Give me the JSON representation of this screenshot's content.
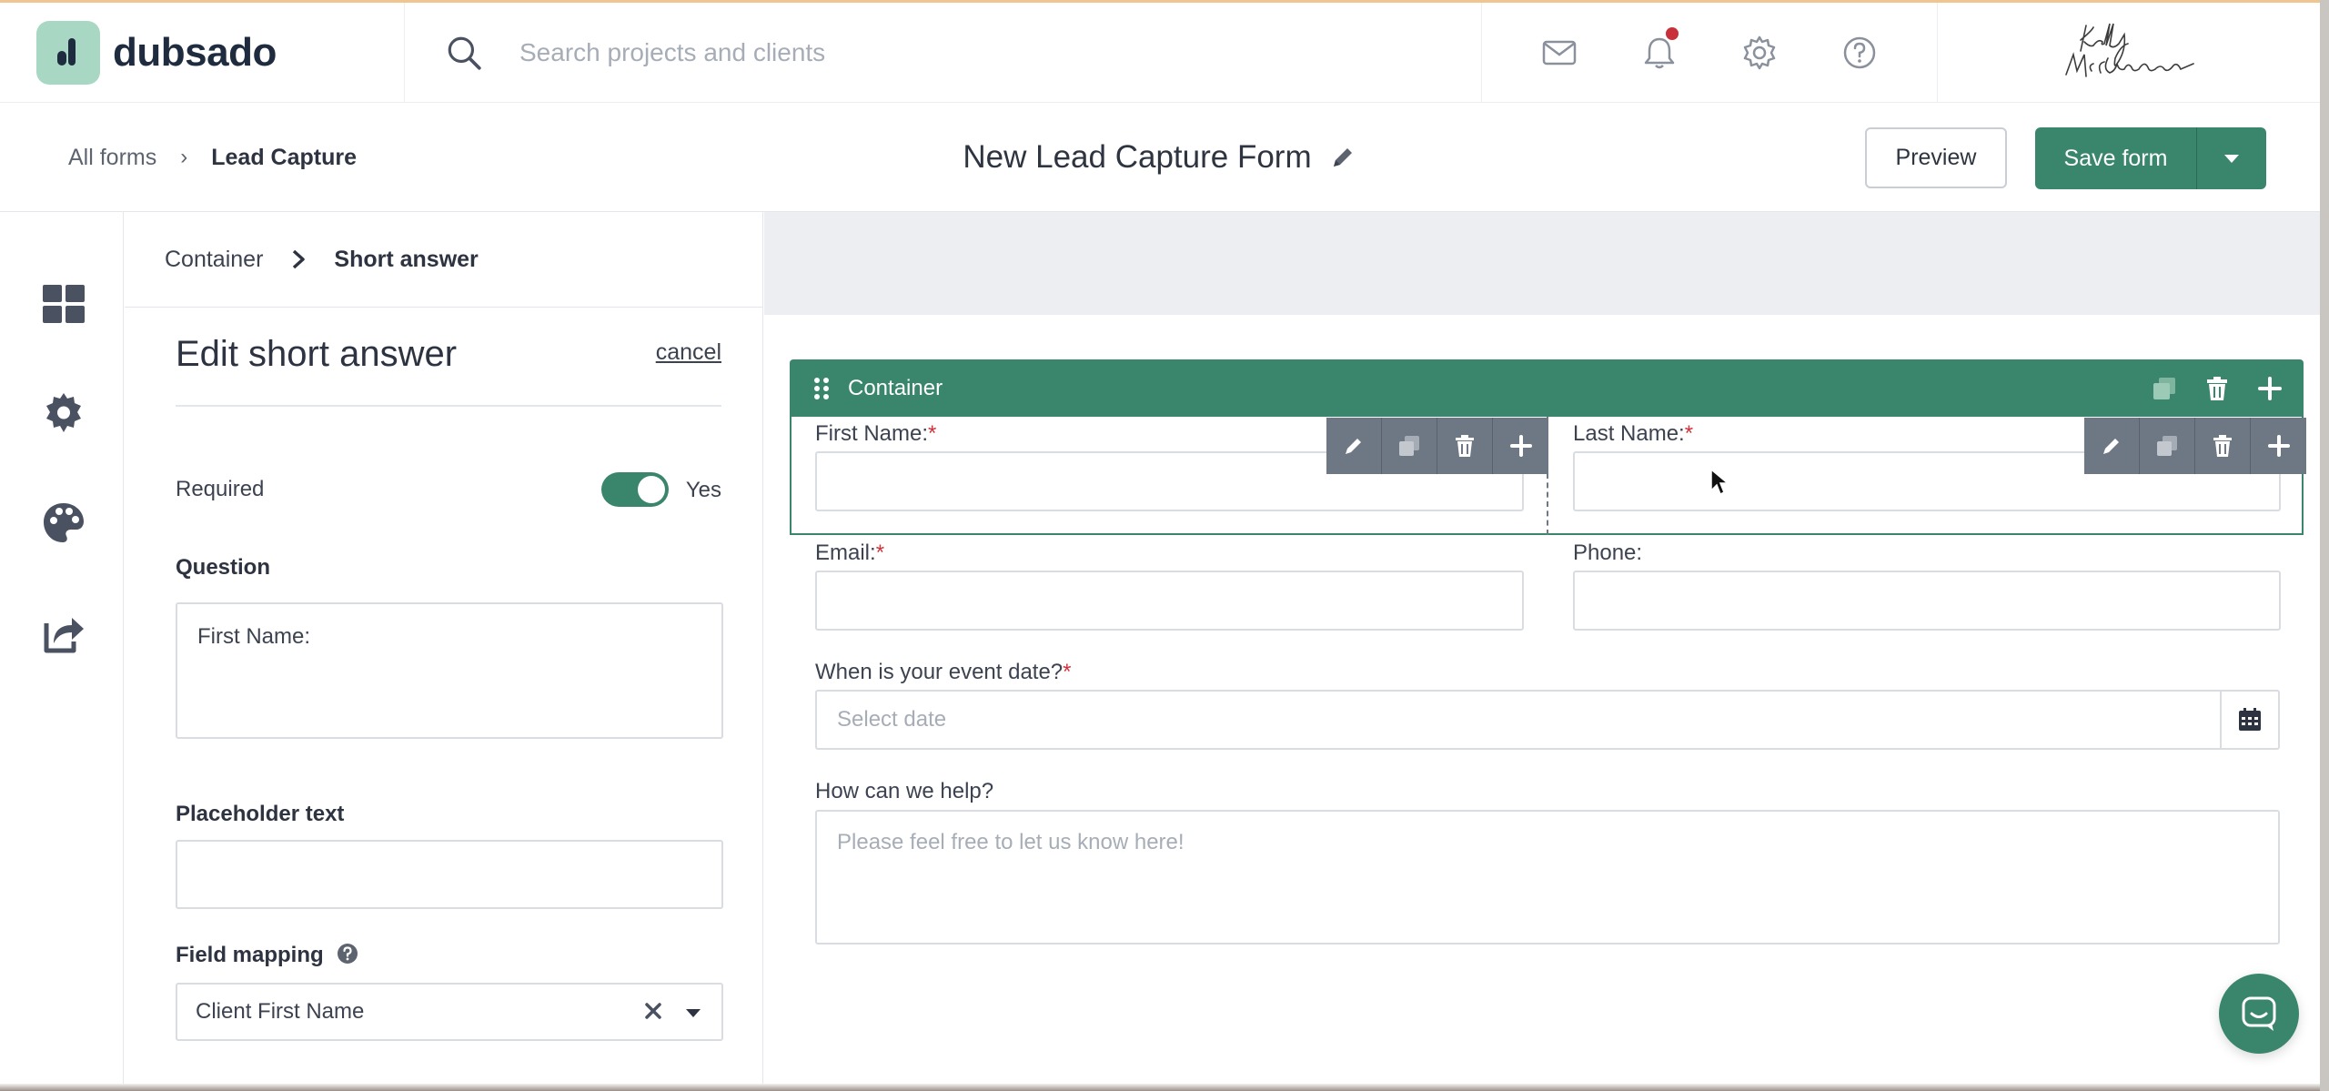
{
  "app": {
    "logo_text": "dubsado",
    "search_placeholder": "Search projects and clients",
    "colors": {
      "brand_green": "#3a866d",
      "logo_tile": "#a8d8c3",
      "notification": "#c8313a"
    }
  },
  "subheader": {
    "breadcrumb": [
      "All forms",
      "Lead Capture"
    ],
    "form_title": "New Lead Capture Form",
    "preview_label": "Preview",
    "save_label": "Save form"
  },
  "panel": {
    "breadcrumb": [
      "Container",
      "Short answer"
    ],
    "title": "Edit short answer",
    "cancel_label": "cancel",
    "required_label": "Required",
    "required_state": "Yes",
    "question_label": "Question",
    "question_value": "First Name:",
    "placeholder_label": "Placeholder text",
    "placeholder_value": "",
    "field_mapping_label": "Field mapping",
    "field_mapping_value": "Client First Name"
  },
  "canvas": {
    "container_title": "Container",
    "fields": {
      "first_name": {
        "label": "First Name:",
        "required": "*"
      },
      "last_name": {
        "label": "Last Name:",
        "required": "*"
      },
      "email": {
        "label": "Email:",
        "required": "*"
      },
      "phone": {
        "label": "Phone:"
      },
      "event_date": {
        "label": "When is your event date?",
        "required": "*",
        "placeholder": "Select date"
      },
      "help": {
        "label": "How can we help?",
        "placeholder": "Please feel free to let us know here!"
      }
    }
  }
}
